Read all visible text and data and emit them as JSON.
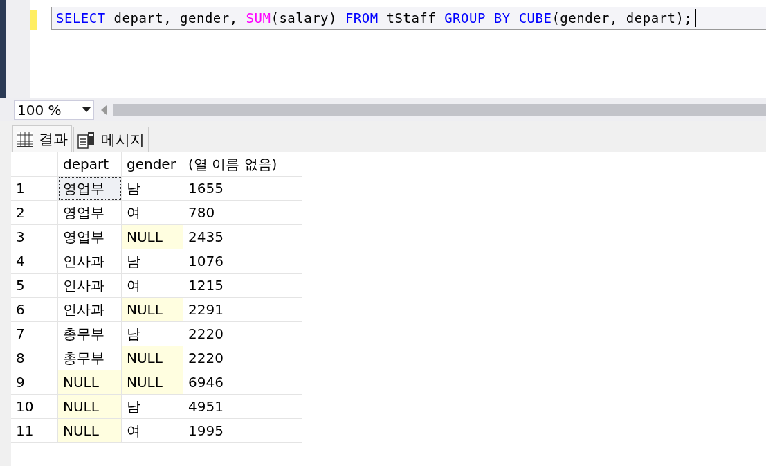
{
  "editor": {
    "modified": true,
    "tokens": [
      {
        "text": "SELECT",
        "kind": "keyword"
      },
      {
        "text": " depart, gender, ",
        "kind": "plain"
      },
      {
        "text": "SUM",
        "kind": "function"
      },
      {
        "text": "(salary) ",
        "kind": "plain"
      },
      {
        "text": "FROM",
        "kind": "keyword"
      },
      {
        "text": " tStaff ",
        "kind": "plain"
      },
      {
        "text": "GROUP BY ",
        "kind": "keyword"
      },
      {
        "text": "CUBE",
        "kind": "keyword"
      },
      {
        "text": "(gender, depart);",
        "kind": "plain"
      }
    ]
  },
  "zoom": {
    "value": "100 %"
  },
  "tabs": [
    {
      "label": "결과",
      "selected": true,
      "kind": "grid"
    },
    {
      "label": "메시지",
      "selected": false,
      "kind": "messages"
    }
  ],
  "table": {
    "columns": [
      "depart",
      "gender",
      "(열 이름 없음)"
    ],
    "rows": [
      {
        "number": "1",
        "cells": [
          {
            "text": "영업부",
            "null": false,
            "focused": true
          },
          {
            "text": "남",
            "null": false,
            "focused": false
          },
          {
            "text": "1655",
            "null": false,
            "focused": false
          }
        ]
      },
      {
        "number": "2",
        "cells": [
          {
            "text": "영업부",
            "null": false,
            "focused": false
          },
          {
            "text": "여",
            "null": false,
            "focused": false
          },
          {
            "text": "780",
            "null": false,
            "focused": false
          }
        ]
      },
      {
        "number": "3",
        "cells": [
          {
            "text": "영업부",
            "null": false,
            "focused": false
          },
          {
            "text": "NULL",
            "null": true,
            "focused": false
          },
          {
            "text": "2435",
            "null": false,
            "focused": false
          }
        ]
      },
      {
        "number": "4",
        "cells": [
          {
            "text": "인사과",
            "null": false,
            "focused": false
          },
          {
            "text": "남",
            "null": false,
            "focused": false
          },
          {
            "text": "1076",
            "null": false,
            "focused": false
          }
        ]
      },
      {
        "number": "5",
        "cells": [
          {
            "text": "인사과",
            "null": false,
            "focused": false
          },
          {
            "text": "여",
            "null": false,
            "focused": false
          },
          {
            "text": "1215",
            "null": false,
            "focused": false
          }
        ]
      },
      {
        "number": "6",
        "cells": [
          {
            "text": "인사과",
            "null": false,
            "focused": false
          },
          {
            "text": "NULL",
            "null": true,
            "focused": false
          },
          {
            "text": "2291",
            "null": false,
            "focused": false
          }
        ]
      },
      {
        "number": "7",
        "cells": [
          {
            "text": "총무부",
            "null": false,
            "focused": false
          },
          {
            "text": "남",
            "null": false,
            "focused": false
          },
          {
            "text": "2220",
            "null": false,
            "focused": false
          }
        ]
      },
      {
        "number": "8",
        "cells": [
          {
            "text": "총무부",
            "null": false,
            "focused": false
          },
          {
            "text": "NULL",
            "null": true,
            "focused": false
          },
          {
            "text": "2220",
            "null": false,
            "focused": false
          }
        ]
      },
      {
        "number": "9",
        "cells": [
          {
            "text": "NULL",
            "null": true,
            "focused": false
          },
          {
            "text": "NULL",
            "null": true,
            "focused": false
          },
          {
            "text": "6946",
            "null": false,
            "focused": false
          }
        ]
      },
      {
        "number": "10",
        "cells": [
          {
            "text": "NULL",
            "null": true,
            "focused": false
          },
          {
            "text": "남",
            "null": false,
            "focused": false
          },
          {
            "text": "4951",
            "null": false,
            "focused": false
          }
        ]
      },
      {
        "number": "11",
        "cells": [
          {
            "text": "NULL",
            "null": true,
            "focused": false
          },
          {
            "text": "여",
            "null": false,
            "focused": false
          },
          {
            "text": "1995",
            "null": false,
            "focused": false
          }
        ]
      }
    ]
  }
}
